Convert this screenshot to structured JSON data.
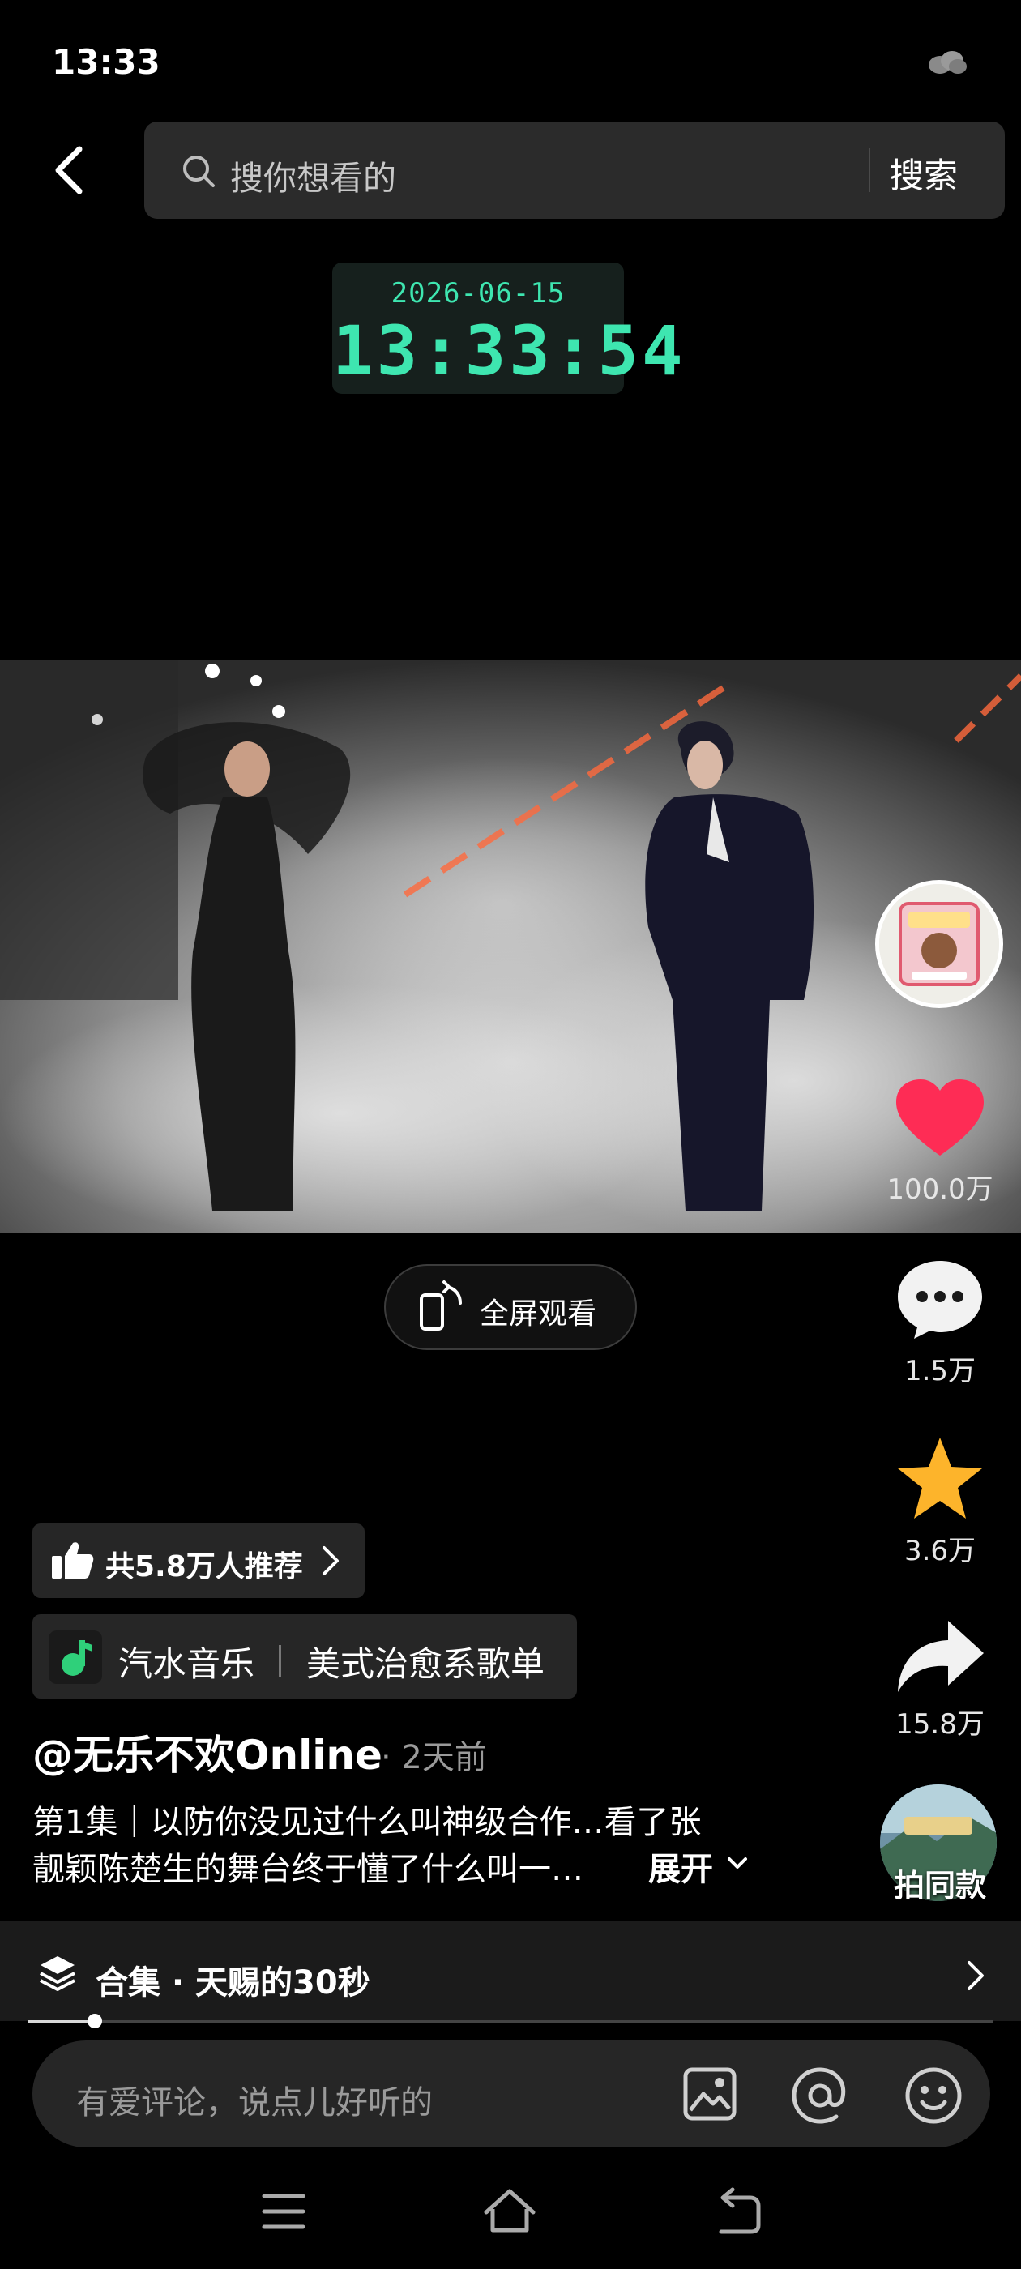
{
  "status_bar": {
    "time": "13:33"
  },
  "search": {
    "placeholder": "搜你想看的",
    "button_label": "搜索"
  },
  "clock": {
    "date": "2026-06-15",
    "time": "13:33:54"
  },
  "fullscreen": {
    "label": "全屏观看"
  },
  "rail": {
    "like_count": "100.0万",
    "comment_count": "1.5万",
    "favorite_count": "3.6万",
    "share_count": "15.8万",
    "same_style_label": "拍同款",
    "like_color": "#fe2c55",
    "favorite_color": "#fdb42b"
  },
  "recommend": {
    "label": "共5.8万人推荐"
  },
  "music": {
    "app": "汽水音乐",
    "playlist": "美式治愈系歌单"
  },
  "post": {
    "author": "@无乐不欢Online",
    "time": "· 2天前",
    "description_line1": "第1集｜以防你没见过什么叫神级合作…看了张",
    "description_line2": "靓颖陈楚生的舞台终于懂了什么叫一…",
    "expand_label": "展开"
  },
  "collection": {
    "label": "合集 · 天赐的30秒",
    "progress": 0.07
  },
  "comment": {
    "placeholder": "有爱评论，说点儿好听的"
  }
}
